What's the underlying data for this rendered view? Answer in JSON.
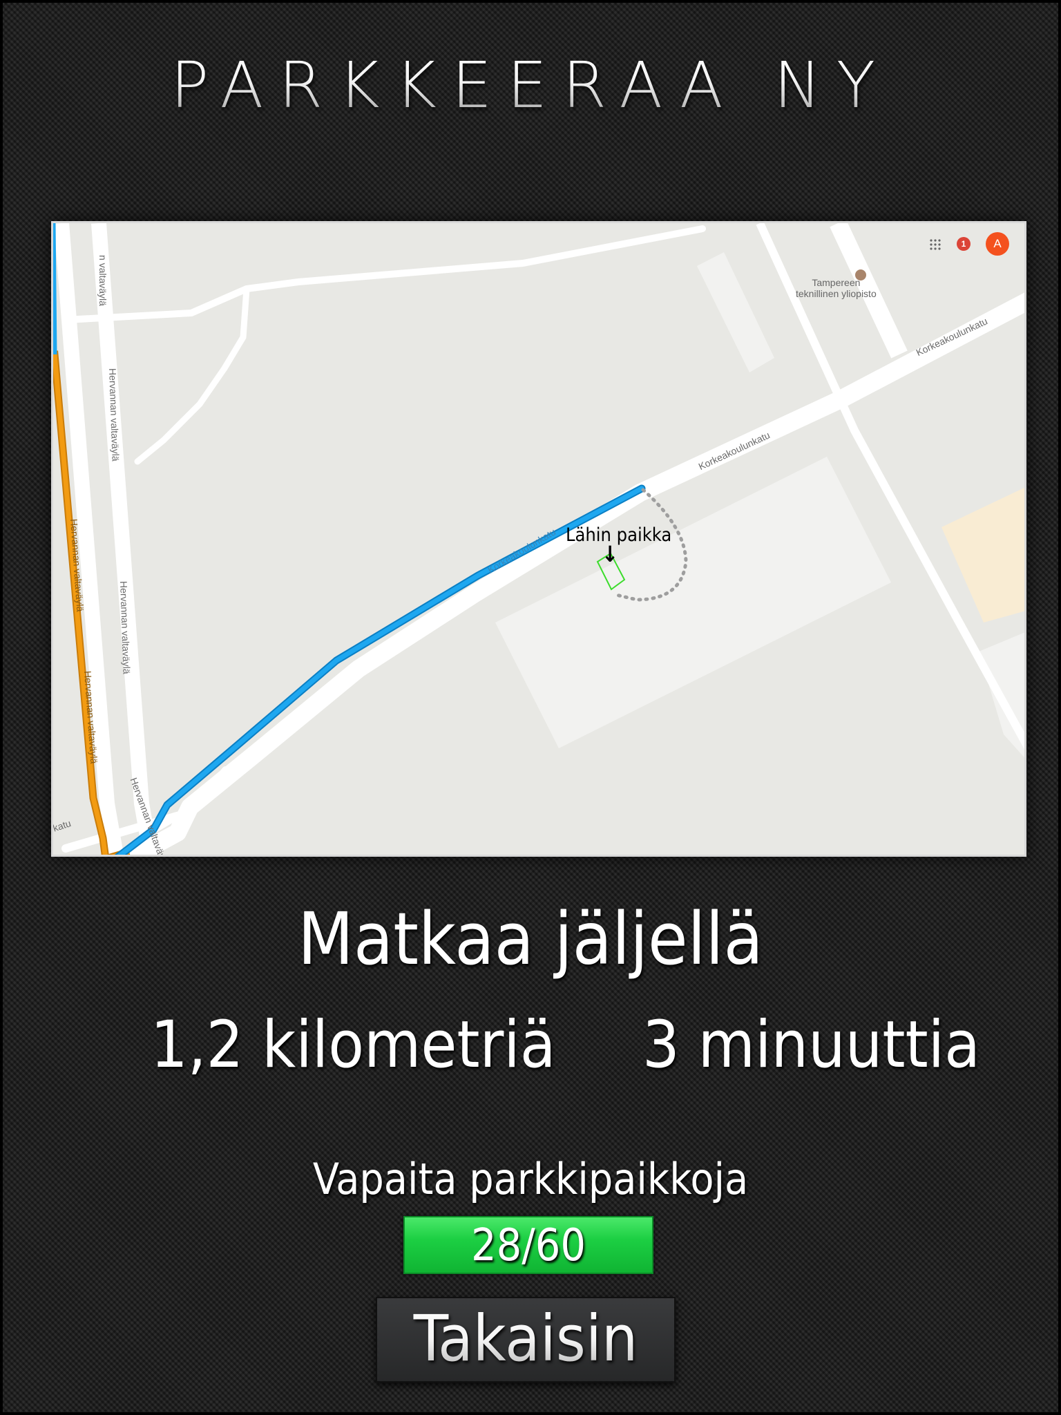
{
  "app": {
    "title": "PARKKEERAA NY"
  },
  "map": {
    "streets": {
      "hervanta": "Hervannan valtaväylä",
      "hervanta_partial": "n valtaväylä",
      "korkeakoulunkatu": "Korkeakoulunkatu",
      "katu_partial": "katu"
    },
    "poi": {
      "line1": "Tampereen",
      "line2": "teknillinen yliopisto",
      "icon": "school-pin-icon"
    },
    "controls": {
      "apps_icon": "apps-grid-icon",
      "notifications": "1",
      "avatar": "A"
    },
    "spot_label": "Lähin paikka",
    "spot_arrow": "↓",
    "colors": {
      "route": "#1ea7f0",
      "traffic": "#f29b12",
      "spot": "#3cdc2c"
    }
  },
  "trip": {
    "title": "Matkaa jäljellä",
    "distance": "1,2 kilometriä",
    "duration": "3 minuuttia"
  },
  "parking": {
    "label": "Vapaita parkkipaikkoja",
    "value": "28/60",
    "free": 28,
    "total": 60,
    "bar_color": "#1ccf43"
  },
  "actions": {
    "back_label": "Takaisin"
  }
}
